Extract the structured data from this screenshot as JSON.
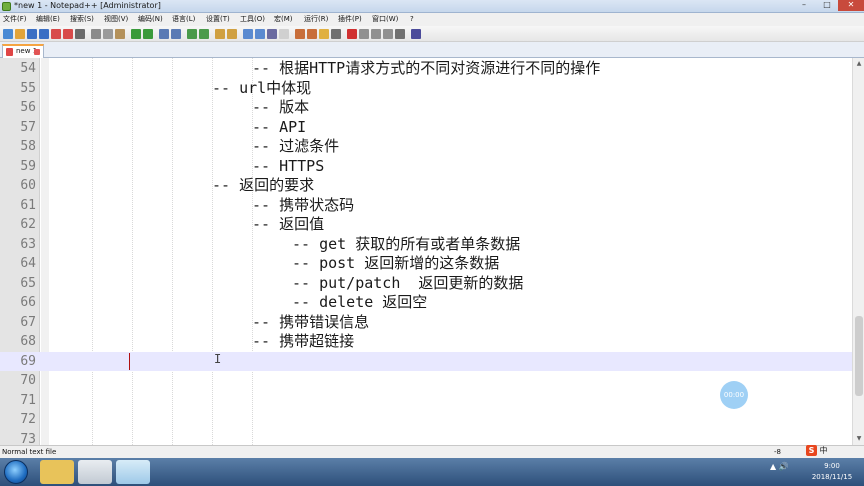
{
  "window": {
    "title": "*new 1 - Notepad++ [Administrator]",
    "controls": {
      "minimize": "–",
      "maximize": "□",
      "close": "✕"
    }
  },
  "menu": [
    "文件(F)",
    "编辑(E)",
    "搜索(S)",
    "视图(V)",
    "编码(N)",
    "语言(L)",
    "设置(T)",
    "工具(O)",
    "宏(M)",
    "运行(R)",
    "插件(P)",
    "窗口(W)",
    "?"
  ],
  "toolbar": {
    "icons": [
      "new-icon",
      "open-icon",
      "save-icon",
      "save-all-icon",
      "close-icon",
      "close-all-icon",
      "print-icon",
      "cut-icon",
      "copy-icon",
      "paste-icon",
      "undo-icon",
      "redo-icon",
      "find-icon",
      "replace-icon",
      "zoom-in-icon",
      "zoom-out-icon",
      "sync-v-icon",
      "sync-h-icon",
      "wrap-icon",
      "show-all-icon",
      "indent-guide-icon",
      "lang-icon",
      "doc-map-icon",
      "func-list-icon",
      "folder-icon",
      "monitor-icon",
      "record-icon",
      "stop-icon",
      "play-icon",
      "play-multi-icon",
      "save-macro-icon",
      "spell-icon"
    ],
    "colors": [
      "#4a8ad4",
      "#e2a43a",
      "#3b6fc4",
      "#3b6fc4",
      "#d84a4a",
      "#d84a4a",
      "#6a6a6a",
      "#8a8a8a",
      "#9a9a9a",
      "#b4915a",
      "#3a9a3a",
      "#3a9a3a",
      "#5a7ab4",
      "#5a7ab4",
      "#4a9a4a",
      "#4a9a4a",
      "#d0a040",
      "#d0a040",
      "#5a8ad0",
      "#5a8ad0",
      "#6a6aa0",
      "#d0d0d0",
      "#c86e3a",
      "#c86e3a",
      "#e0b040",
      "#707070",
      "#d03030",
      "#909090",
      "#909090",
      "#909090",
      "#707070",
      "#4a4a9a"
    ]
  },
  "tabs": [
    {
      "label": "new 1"
    }
  ],
  "editor": {
    "current_line": "69",
    "lines": [
      {
        "num": "54",
        "text": "-- 根据HTTP请求方式的不同对资源进行不同的操作",
        "indent": 2
      },
      {
        "num": "55",
        "text": "-- url中体现",
        "indent": 1
      },
      {
        "num": "56",
        "text": "-- 版本",
        "indent": 2
      },
      {
        "num": "57",
        "text": "-- API",
        "indent": 2
      },
      {
        "num": "58",
        "text": "-- 过滤条件",
        "indent": 2
      },
      {
        "num": "59",
        "text": "-- HTTPS",
        "indent": 2
      },
      {
        "num": "60",
        "text": "-- 返回的要求",
        "indent": 1
      },
      {
        "num": "61",
        "text": "-- 携带状态码",
        "indent": 2
      },
      {
        "num": "62",
        "text": "-- 返回值",
        "indent": 2
      },
      {
        "num": "63",
        "text": "-- get 获取的所有或者单条数据",
        "indent": 3
      },
      {
        "num": "64",
        "text": "-- post 返回新增的这条数据",
        "indent": 3
      },
      {
        "num": "65",
        "text": "-- put/patch  返回更新的数据",
        "indent": 3
      },
      {
        "num": "66",
        "text": "-- delete 返回空",
        "indent": 3
      },
      {
        "num": "67",
        "text": "-- 携带错误信息",
        "indent": 2
      },
      {
        "num": "68",
        "text": "-- 携带超链接",
        "indent": 2
      },
      {
        "num": "69",
        "text": "",
        "indent": 0
      },
      {
        "num": "70",
        "text": "",
        "indent": 0
      },
      {
        "num": "71",
        "text": "",
        "indent": 0
      },
      {
        "num": "72",
        "text": "",
        "indent": 0
      },
      {
        "num": "73",
        "text": "",
        "indent": 0
      }
    ]
  },
  "bubble": {
    "text": "00:00"
  },
  "status": {
    "file_type": "Normal text file",
    "right": "-8"
  },
  "ime": {
    "logo": "S",
    "mode": "中"
  },
  "tray": {
    "icons": "▲ 🔊"
  },
  "clock": {
    "time": "9:00",
    "date": "2018/11/15"
  },
  "taskbar": {
    "buttons": [
      "explorer-button",
      "notepadpp-button",
      "active-app-button"
    ],
    "colors": [
      "#e8c35a",
      "#d0d6dc",
      "#9ec9e8"
    ]
  }
}
